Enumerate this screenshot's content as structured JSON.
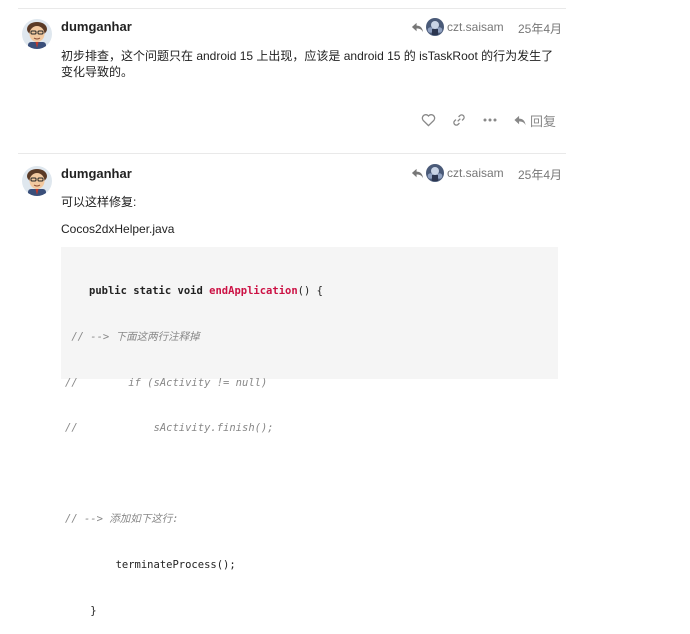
{
  "posts": [
    {
      "username": "dumganhar",
      "reply_to": "czt.saisam",
      "date": "25年4月",
      "text": "初步排查，这个问题只在 android 15 上出现，应该是 android 15 的 isTaskRoot 的行为发生了变化导致的。",
      "actions": {
        "like_icon": "heart-icon",
        "link_icon": "link-icon",
        "more_icon": "ellipsis-icon",
        "reply_label": "回复"
      }
    },
    {
      "username": "dumganhar",
      "reply_to": "czt.saisam",
      "date": "25年4月",
      "text": "可以这样修复:",
      "filename": "Cocos2dxHelper.java",
      "code": {
        "line1_kw1": "public",
        "line1_kw2": "static",
        "line1_kw3": "void",
        "line1_fn": "endApplication",
        "line1_tail": "() {",
        "line2": " // --> 下面这两行注释掉",
        "line3": "//        if (sActivity != null)",
        "line4": "//            sActivity.finish();",
        "line5": "",
        "line6": "// --> 添加如下这行:",
        "line7": "        terminateProcess();",
        "line8": "    }"
      }
    }
  ]
}
